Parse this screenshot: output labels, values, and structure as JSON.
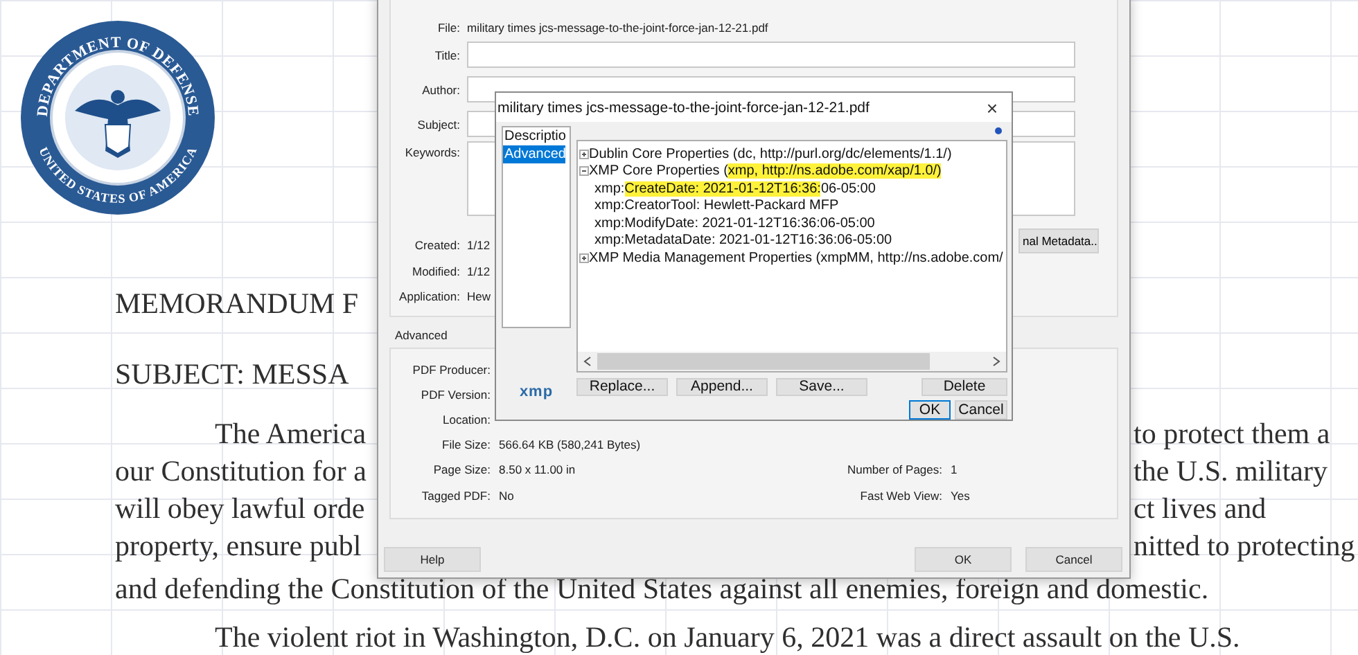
{
  "document": {
    "seal": {
      "top_text": "DEPARTMENT OF DEFENSE",
      "bottom_text": "UNITED STATES OF AMERICA"
    },
    "header_lines": [
      {
        "left": "MEMORANDUM F"
      },
      {
        "left": "SUBJECT:  MESSA"
      }
    ],
    "paragraph_lines": [
      {
        "left": "The America",
        "right": "to protect them a",
        "indent": true
      },
      {
        "left": "our Constitution for a",
        "right": "the U.S. military",
        "indent": false
      },
      {
        "left": "will obey lawful orde",
        "right": "ct lives and",
        "indent": false
      },
      {
        "left": "property, ensure publ",
        "right": "nitted to protecting",
        "indent": false
      },
      {
        "left": "and defending the Constitution of the United States against all enemies, foreign and domestic.",
        "indent": false
      }
    ],
    "next_paragraph": "The violent riot in Washington, D.C. on January 6, 2021 was a direct assault on the U.S."
  },
  "properties_dialog": {
    "file_label": "File:",
    "file_value": "military times jcs-message-to-the-joint-force-jan-12-21.pdf",
    "fields": [
      {
        "label": "Title:",
        "kind": "line"
      },
      {
        "label": "Author:",
        "kind": "line"
      },
      {
        "label": "Subject:",
        "kind": "line"
      },
      {
        "label": "Keywords:",
        "kind": "area"
      }
    ],
    "dates": [
      {
        "label": "Created:",
        "value": "1/12"
      },
      {
        "label": "Modified:",
        "value": "1/12"
      },
      {
        "label": "Application:",
        "value": "Hew"
      }
    ],
    "metadata_button": "nal Metadata..",
    "advanced_title": "Advanced",
    "advanced_rows": [
      {
        "label": "PDF Producer:",
        "value": ""
      },
      {
        "label": "PDF Version:",
        "value": ""
      },
      {
        "label": "Location:",
        "value": ""
      },
      {
        "label": "File Size:",
        "value": "566.64 KB (580,241 Bytes)"
      },
      {
        "label": "Page Size:",
        "value": "8.50 x 11.00 in",
        "label2": "Number of Pages:",
        "value2": "1"
      },
      {
        "label": "Tagged PDF:",
        "value": "No",
        "label2": "Fast Web View:",
        "value2": "Yes"
      }
    ],
    "buttons": [
      {
        "label": "Help",
        "kind": "left"
      },
      {
        "label": "OK",
        "kind": "right"
      },
      {
        "label": "Cancel",
        "kind": "right"
      }
    ]
  },
  "xmp_dialog": {
    "title": "military times jcs-message-to-the-joint-force-jan-12-21.pdf",
    "close": "×",
    "categories": [
      {
        "label": "Descriptio",
        "selected": false
      },
      {
        "label": "Advanced",
        "selected": true
      }
    ],
    "tree": [
      {
        "expanded": false,
        "segments": [
          {
            "text": "Dublin Core Properties (dc, http://purl.org/dc/elements/1.1/)",
            "highlight": false
          }
        ]
      },
      {
        "expanded": true,
        "segments": [
          {
            "text": "XMP Core Properties (",
            "highlight": false
          },
          {
            "text": "xmp, http://ns.adobe.com/xap/1.0/)",
            "highlight": true
          }
        ],
        "children": [
          {
            "segments": [
              {
                "text": "xmp:",
                "highlight": false
              },
              {
                "text": "CreateDate: 2021-01-12T16:36:",
                "highlight": true
              },
              {
                "text": "06-05:00",
                "highlight": false
              }
            ]
          },
          {
            "segments": [
              {
                "text": "xmp:CreatorTool: Hewlett-Packard MFP",
                "highlight": false
              }
            ]
          },
          {
            "segments": [
              {
                "text": "xmp:ModifyDate: 2021-01-12T16:36:06-05:00",
                "highlight": false
              }
            ]
          },
          {
            "segments": [
              {
                "text": "xmp:MetadataDate: 2021-01-12T16:36:06-05:00",
                "highlight": false
              }
            ]
          }
        ]
      },
      {
        "expanded": false,
        "segments": [
          {
            "text": "XMP Media Management Properties (xmpMM, http://ns.adobe.com/",
            "highlight": false
          }
        ]
      }
    ],
    "logo": "xmp",
    "action_buttons": [
      "Replace...",
      "Append...",
      "Save...",
      "Delete"
    ],
    "buttons": [
      {
        "label": "OK",
        "focused": true
      },
      {
        "label": "Cancel",
        "focused": false
      }
    ]
  }
}
